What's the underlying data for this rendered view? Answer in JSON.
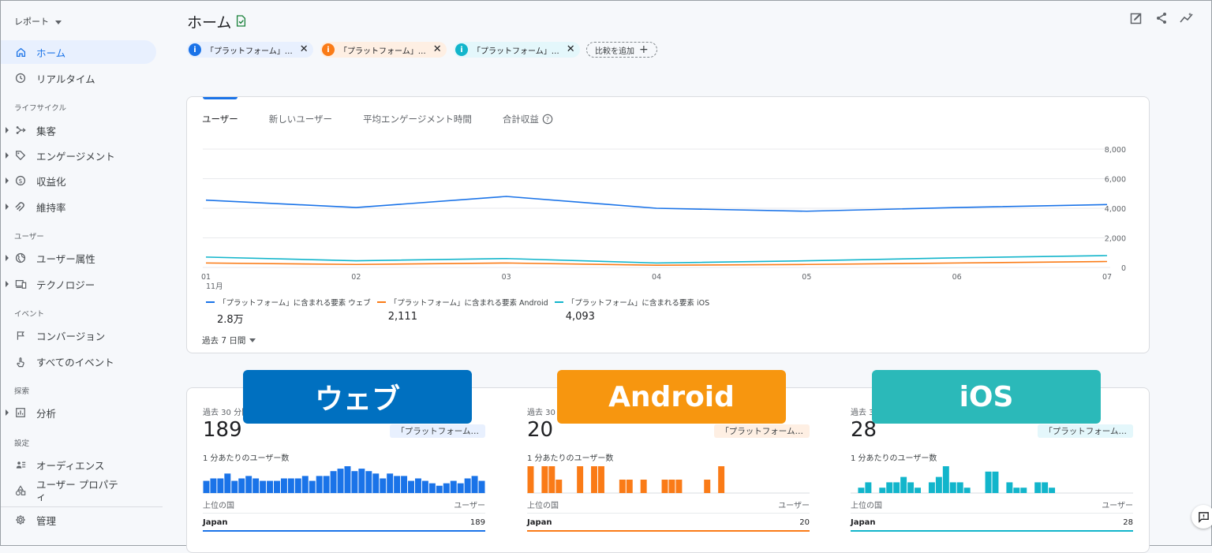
{
  "sidebar": {
    "report_selector": "レポート",
    "home": "ホーム",
    "realtime": "リアルタイム",
    "section_lifecycle": "ライフサイクル",
    "acquisition": "集客",
    "engagement": "エンゲージメント",
    "monetization": "収益化",
    "retention": "維持率",
    "section_user": "ユーザー",
    "user_attributes": "ユーザー属性",
    "technology": "テクノロジー",
    "section_events": "イベント",
    "conversions": "コンバージョン",
    "all_events": "すべてのイベント",
    "section_explore": "探索",
    "analysis": "分析",
    "section_config": "設定",
    "audiences": "オーディエンス",
    "user_properties_1": "ユーザー プロパテ",
    "user_properties_2": "ィ",
    "admin": "管理"
  },
  "header": {
    "title": "ホーム",
    "chips": [
      {
        "label": "「プラットフォーム」…",
        "color": "#1a73e8",
        "bg": "#e8f0fe"
      },
      {
        "label": "「プラットフォーム」…",
        "color": "#fa7b17",
        "bg": "#feefe3"
      },
      {
        "label": "「プラットフォーム」…",
        "color": "#12b5cb",
        "bg": "#e4f7fb"
      }
    ],
    "add_comparison": "比較を追加"
  },
  "overview": {
    "tabs": [
      "ユーザー",
      "新しいユーザー",
      "平均エンゲージメント時間",
      "合計収益"
    ],
    "active_tab": 0,
    "legend": [
      {
        "label": "「プラットフォーム」に含まれる要素 ウェブ",
        "value": "2.8万",
        "color": "#1a73e8"
      },
      {
        "label": "「プラットフォーム」に含まれる要素 Android",
        "value": "2,111",
        "color": "#fa7b17"
      },
      {
        "label": "「プラットフォーム」に含まれる要素 iOS",
        "value": "4,093",
        "color": "#12b5cb"
      }
    ],
    "period": "過去 7 日間",
    "month_label": "11月"
  },
  "chart_data": {
    "type": "line",
    "x": [
      "01",
      "02",
      "03",
      "04",
      "05",
      "06",
      "07"
    ],
    "x_sub_label": "11月",
    "ylim": [
      0,
      8000
    ],
    "y_ticks": [
      "8,000",
      "6,000",
      "4,000",
      "2,000",
      "0"
    ],
    "y_tick_values": [
      8000,
      6000,
      4000,
      2000,
      0
    ],
    "grid": true,
    "series": [
      {
        "name": "「プラットフォーム」に含まれる要素 ウェブ",
        "color": "#1a73e8",
        "values": [
          4550,
          4050,
          4800,
          4000,
          3800,
          4050,
          4250
        ]
      },
      {
        "name": "「プラットフォーム」に含まれる要素 Android",
        "color": "#fa7b17",
        "values": [
          300,
          200,
          300,
          150,
          200,
          300,
          400
        ]
      },
      {
        "name": "「プラットフォーム」に含まれる要素 iOS",
        "color": "#12b5cb",
        "values": [
          700,
          450,
          600,
          300,
          450,
          650,
          800
        ]
      }
    ]
  },
  "realtime": [
    {
      "label": "ウェブ",
      "label_bg": "#0070c0",
      "subtitle": "過去 30 分間",
      "count": "189",
      "pill": "「プラットフォーム…",
      "pill_bg": "#e8f0fe",
      "color": "#1a73e8",
      "per_minute": "1 分あたりのユーザー数",
      "col_country": "上位の国",
      "col_users": "ユーザー",
      "country": "Japan",
      "country_count": "189",
      "bars": [
        5,
        6,
        6,
        8,
        5,
        6,
        7,
        6,
        5,
        5,
        5,
        6,
        6,
        6,
        7,
        5,
        7,
        7,
        9,
        10,
        11,
        9,
        10,
        9,
        8,
        6,
        8,
        7,
        7,
        5,
        6,
        5,
        4,
        3,
        4,
        5,
        4,
        6,
        7,
        5
      ]
    },
    {
      "label": "Android",
      "label_bg": "#f7960f",
      "subtitle": "過去 30 分間",
      "count": "20",
      "pill": "「プラットフォーム…",
      "pill_bg": "#feefe3",
      "color": "#fa7b17",
      "per_minute": "1 分あたりのユーザー数",
      "col_country": "上位の国",
      "col_users": "ユーザー",
      "country": "Japan",
      "country_count": "20",
      "bars": [
        2,
        0,
        2,
        2,
        1,
        0,
        0,
        2,
        0,
        2,
        2,
        0,
        0,
        1,
        1,
        0,
        1,
        0,
        0,
        1,
        1,
        1,
        0,
        0,
        0,
        1,
        0,
        2,
        0,
        0,
        0,
        0,
        0,
        0,
        0,
        0,
        0,
        0,
        0,
        0
      ]
    },
    {
      "label": "iOS",
      "label_bg": "#2bb9b9",
      "subtitle": "過去 30 分間",
      "count": "28",
      "pill": "「プラットフォーム…",
      "pill_bg": "#e4f7fb",
      "color": "#12b5cb",
      "per_minute": "1 分あたりのユーザー数",
      "col_country": "上位の国",
      "col_users": "ユーザー",
      "country": "Japan",
      "country_count": "28",
      "bars": [
        0,
        1,
        2,
        0,
        1,
        2,
        2,
        3,
        2,
        1,
        0,
        2,
        3,
        5,
        2,
        2,
        1,
        0,
        0,
        4,
        4,
        0,
        2,
        1,
        1,
        0,
        2,
        2,
        1,
        0,
        0,
        0,
        0,
        0,
        0,
        0,
        0,
        0,
        0,
        0
      ]
    }
  ]
}
